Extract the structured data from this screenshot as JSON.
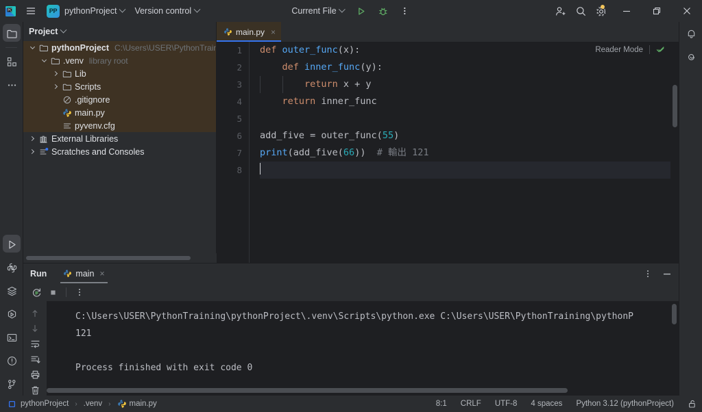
{
  "titlebar": {
    "app_icon": "pycharm-logo-icon",
    "menu_icon": "hamburger-menu-icon",
    "project_badge": "PP",
    "project_name": "pythonProject",
    "version_control": "Version control",
    "run_config": "Current File",
    "run_icon": "run-icon",
    "debug_icon": "debug-icon",
    "more_icon": "more-vertical-icon",
    "add_user_icon": "add-user-icon",
    "search_icon": "search-icon",
    "settings_icon": "gear-icon",
    "minimize_icon": "minimize-icon",
    "maximize_icon": "restore-icon",
    "close_icon": "close-icon"
  },
  "toolstrip": {
    "items": [
      {
        "name": "project-tool-icon",
        "selected": true
      },
      {
        "name": "structure-tool-icon",
        "selected": false
      },
      {
        "name": "more-tool-windows-icon",
        "selected": false
      }
    ],
    "bottom_items": [
      {
        "name": "run-tool-icon",
        "selected": true
      },
      {
        "name": "python-packages-icon",
        "selected": false
      },
      {
        "name": "services-icon",
        "selected": false
      },
      {
        "name": "python-console-icon",
        "selected": false
      },
      {
        "name": "terminal-icon",
        "selected": false
      },
      {
        "name": "problems-icon",
        "selected": false
      },
      {
        "name": "version-control-icon",
        "selected": false
      }
    ]
  },
  "rightstrip": {
    "items": [
      {
        "name": "notifications-bell-icon"
      },
      {
        "name": "ai-assistant-icon"
      }
    ]
  },
  "project_panel": {
    "header": "Project",
    "tree": [
      {
        "label": "pythonProject",
        "sub": "C:\\Users\\USER\\PythonTraining\\pytho",
        "arrow": "open",
        "icon": "folder-icon",
        "depth": 0,
        "bold": true,
        "highlight": true
      },
      {
        "label": ".venv",
        "sub": "library root",
        "arrow": "open",
        "icon": "folder-icon",
        "depth": 1,
        "bold": false,
        "highlight": true
      },
      {
        "label": "Lib",
        "sub": "",
        "arrow": "closed",
        "icon": "folder-icon",
        "depth": 2,
        "bold": false,
        "highlight": true
      },
      {
        "label": "Scripts",
        "sub": "",
        "arrow": "closed",
        "icon": "folder-icon",
        "depth": 2,
        "bold": false,
        "highlight": true
      },
      {
        "label": ".gitignore",
        "sub": "",
        "arrow": "none",
        "icon": "gitignore-icon",
        "depth": 2,
        "bold": false,
        "highlight": true
      },
      {
        "label": "main.py",
        "sub": "",
        "arrow": "none",
        "icon": "python-file-icon",
        "depth": 2,
        "bold": false,
        "highlight": true
      },
      {
        "label": "pyvenv.cfg",
        "sub": "",
        "arrow": "none",
        "icon": "config-file-icon",
        "depth": 2,
        "bold": false,
        "highlight": true
      },
      {
        "label": "External Libraries",
        "sub": "",
        "arrow": "closed",
        "icon": "libraries-icon",
        "depth": 0,
        "bold": false,
        "highlight": false
      },
      {
        "label": "Scratches and Consoles",
        "sub": "",
        "arrow": "closed",
        "icon": "scratches-icon",
        "depth": 0,
        "bold": false,
        "highlight": false
      }
    ]
  },
  "editor": {
    "tab": {
      "label": "main.py",
      "icon": "python-file-icon",
      "close": "×"
    },
    "reader_mode": {
      "label": "Reader Mode",
      "check_icon": "checkmark-icon"
    },
    "line_numbers": [
      "1",
      "2",
      "3",
      "4",
      "5",
      "6",
      "7",
      "8"
    ],
    "code_lines": [
      [
        {
          "t": "def ",
          "c": "kw"
        },
        {
          "t": "outer_func",
          "c": "fn"
        },
        {
          "t": "(x):",
          "c": "pl"
        }
      ],
      [
        {
          "t": "    def ",
          "c": "kw"
        },
        {
          "t": "inner_func",
          "c": "fn"
        },
        {
          "t": "(y):",
          "c": "pl"
        }
      ],
      [
        {
          "t": "        return",
          "c": "kw"
        },
        {
          "t": " x + y",
          "c": "pl"
        }
      ],
      [
        {
          "t": "    return",
          "c": "kw"
        },
        {
          "t": " inner_func",
          "c": "pl"
        }
      ],
      [],
      [
        {
          "t": "add_five = outer_func(",
          "c": "pl"
        },
        {
          "t": "55",
          "c": "num"
        },
        {
          "t": ")",
          "c": "pl"
        }
      ],
      [
        {
          "t": "print",
          "c": "fn"
        },
        {
          "t": "(add_five(",
          "c": "pl"
        },
        {
          "t": "66",
          "c": "num"
        },
        {
          "t": "))  ",
          "c": "pl"
        },
        {
          "t": "# 輸出 121",
          "c": "cm"
        }
      ],
      []
    ]
  },
  "run_panel": {
    "title": "Run",
    "tab": {
      "label": "main",
      "icon": "python-file-icon",
      "close": "×"
    },
    "toolbar": [
      {
        "name": "rerun-icon"
      },
      {
        "name": "stop-icon"
      },
      {
        "name": "more-vertical-icon"
      }
    ],
    "header_right": [
      {
        "name": "options-menu-icon"
      },
      {
        "name": "hide-panel-icon"
      }
    ],
    "side_buttons": [
      {
        "name": "scroll-up-icon"
      },
      {
        "name": "scroll-down-icon"
      },
      {
        "name": "soft-wrap-icon"
      },
      {
        "name": "scroll-to-end-icon"
      },
      {
        "name": "print-icon"
      },
      {
        "name": "clear-all-icon"
      }
    ],
    "console_lines": [
      "C:\\Users\\USER\\PythonTraining\\pythonProject\\.venv\\Scripts\\python.exe C:\\Users\\USER\\PythonTraining\\pythonP",
      "121",
      "",
      "Process finished with exit code 0"
    ]
  },
  "statusbar": {
    "breadcrumb": [
      {
        "label": "pythonProject",
        "icon": "module-icon"
      },
      {
        "label": ".venv",
        "icon": "none"
      },
      {
        "label": "main.py",
        "icon": "python-file-icon"
      }
    ],
    "separator": "›",
    "caret_position": "8:1",
    "line_separator": "CRLF",
    "encoding": "UTF-8",
    "indent": "4 spaces",
    "interpreter": "Python 3.12 (pythonProject)",
    "lock_icon": "unlocked-icon"
  },
  "colors": {
    "accent_blue": "#3574f0",
    "keyword_orange": "#cf8e6d",
    "function_blue": "#56a8f5",
    "number_teal": "#2aacb8",
    "comment_gray": "#7a7e85",
    "editor_bg": "#1e1f22",
    "panel_bg": "#2b2d30",
    "tab_highlight": "#3a3124"
  }
}
